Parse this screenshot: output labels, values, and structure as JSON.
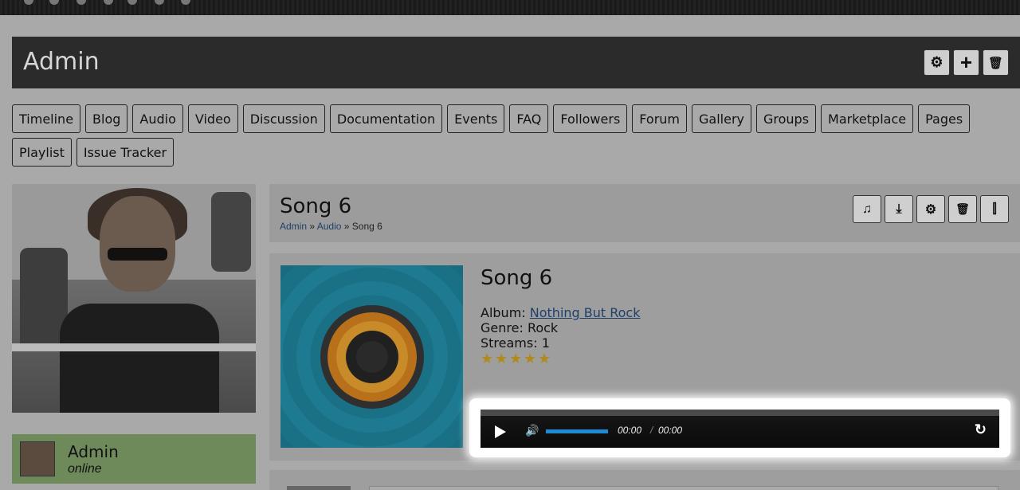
{
  "admin_bar": {
    "title": "Admin",
    "buttons": [
      {
        "icon": "gear-icon",
        "glyph": "⚙"
      },
      {
        "icon": "plus-icon",
        "glyph": "+"
      },
      {
        "icon": "trash-icon",
        "glyph": "🗑"
      }
    ]
  },
  "tabs": [
    "Timeline",
    "Blog",
    "Audio",
    "Video",
    "Discussion",
    "Documentation",
    "Events",
    "FAQ",
    "Followers",
    "Forum",
    "Gallery",
    "Groups",
    "Marketplace",
    "Pages",
    "Playlist",
    "Issue Tracker"
  ],
  "user": {
    "name": "Admin",
    "status": "online"
  },
  "song_header": {
    "title": "Song 6",
    "breadcrumb": {
      "crumb1": "Admin",
      "sep": "»",
      "crumb2": "Audio",
      "current": "Song 6"
    },
    "buttons": [
      {
        "icon": "music-note-icon",
        "glyph": "♫"
      },
      {
        "icon": "download-icon",
        "glyph": "⤓"
      },
      {
        "icon": "gear-icon",
        "glyph": "⚙"
      },
      {
        "icon": "trash-icon",
        "glyph": "🗑"
      },
      {
        "icon": "equalizer-icon",
        "glyph": "⫿"
      }
    ]
  },
  "song": {
    "title": "Song 6",
    "album_label": "Album:",
    "album": "Nothing But Rock",
    "genre_label": "Genre:",
    "genre": "Rock",
    "streams_label": "Streams:",
    "streams": "1",
    "rating": 5,
    "rating_max": 5
  },
  "player": {
    "current_time": "00:00",
    "separator": "/",
    "duration": "00:00",
    "volume": 1.0,
    "accent": "#1e8ad4"
  }
}
